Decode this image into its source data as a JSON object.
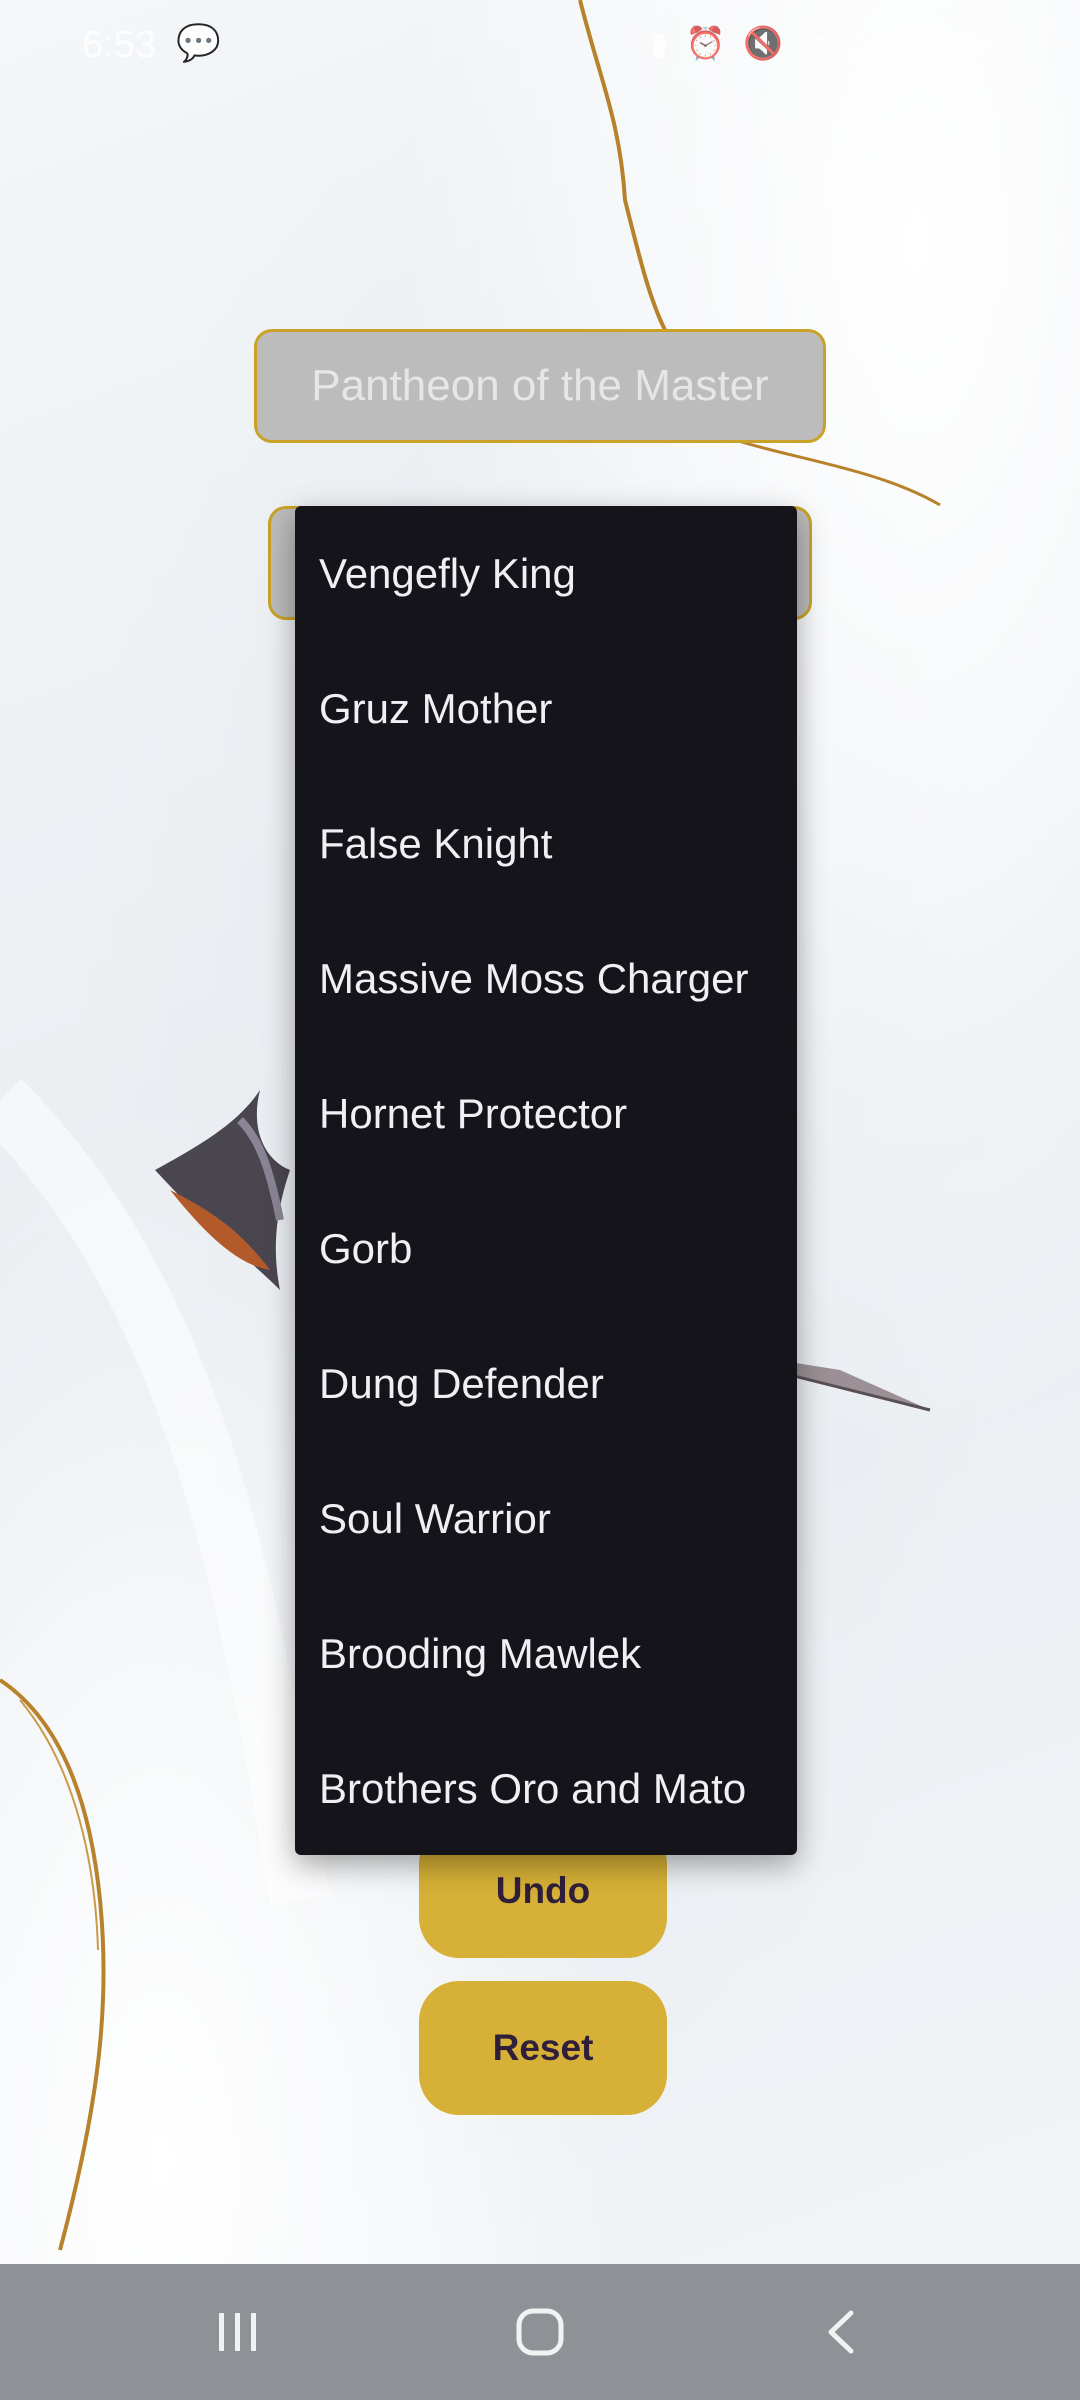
{
  "status_bar": {
    "time": "6:53",
    "battery": "70%"
  },
  "pantheon_select": {
    "value": "Pantheon of the Master"
  },
  "dropdown": {
    "items": [
      "Vengefly King",
      "Gruz Mother",
      "False Knight",
      "Massive Moss Charger",
      "Hornet Protector",
      "Gorb",
      "Dung Defender",
      "Soul Warrior",
      "Brooding Mawlek",
      "Brothers Oro and Mato"
    ]
  },
  "buttons": {
    "undo": "Undo",
    "reset": "Reset"
  },
  "colors": {
    "accent": "#d6b037",
    "dropdown_bg": "#16141b",
    "button_text": "#2f1f3a"
  }
}
